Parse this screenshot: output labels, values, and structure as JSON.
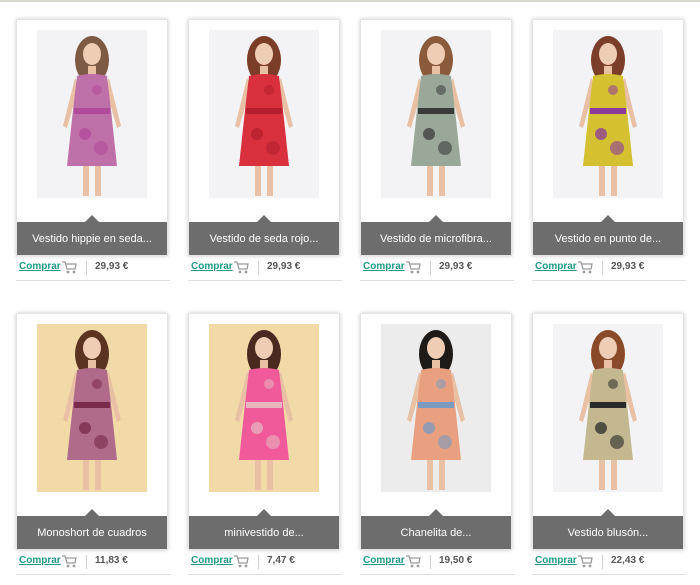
{
  "buy_label": "Comprar",
  "accent_color": "#1e9a86",
  "caption_bg": "#6d6d6d",
  "products": [
    {
      "name": "Vestido hippie en seda...",
      "price": "29,93 €",
      "colors": [
        "#f3f3f6",
        "#c070a8",
        "#b04a9a",
        "#7c5a44"
      ]
    },
    {
      "name": "Vestido de seda rojo...",
      "price": "29,93 €",
      "colors": [
        "#f3f3f6",
        "#d8303c",
        "#b41f2e",
        "#7a3d28"
      ]
    },
    {
      "name": "Vestido de microfibra...",
      "price": "29,93 €",
      "colors": [
        "#f3f3f6",
        "#9aa89a",
        "#3a3a3a",
        "#8a5a3a"
      ]
    },
    {
      "name": "Vestido en punto de...",
      "price": "29,93 €",
      "colors": [
        "#f3f3f6",
        "#d4c030",
        "#8a3a9a",
        "#7a3e2a"
      ]
    },
    {
      "name": "Monoshort de cuadros",
      "price": "11,83 €",
      "colors": [
        "#f1d9a8",
        "#b06a8a",
        "#7a2a4a",
        "#5a3420"
      ]
    },
    {
      "name": "minivestido de...",
      "price": "7,47 €",
      "colors": [
        "#f1d9a8",
        "#f05a9a",
        "#e8b4c0",
        "#4a2a20"
      ]
    },
    {
      "name": "Chanelita de...",
      "price": "19,50 €",
      "colors": [
        "#ececec",
        "#e8a080",
        "#7a9ac0",
        "#1e1a18"
      ]
    },
    {
      "name": "Vestido blusón...",
      "price": "22,43 €",
      "colors": [
        "#f3f3f6",
        "#c4b890",
        "#2a2a2a",
        "#8a4a2a"
      ]
    }
  ]
}
